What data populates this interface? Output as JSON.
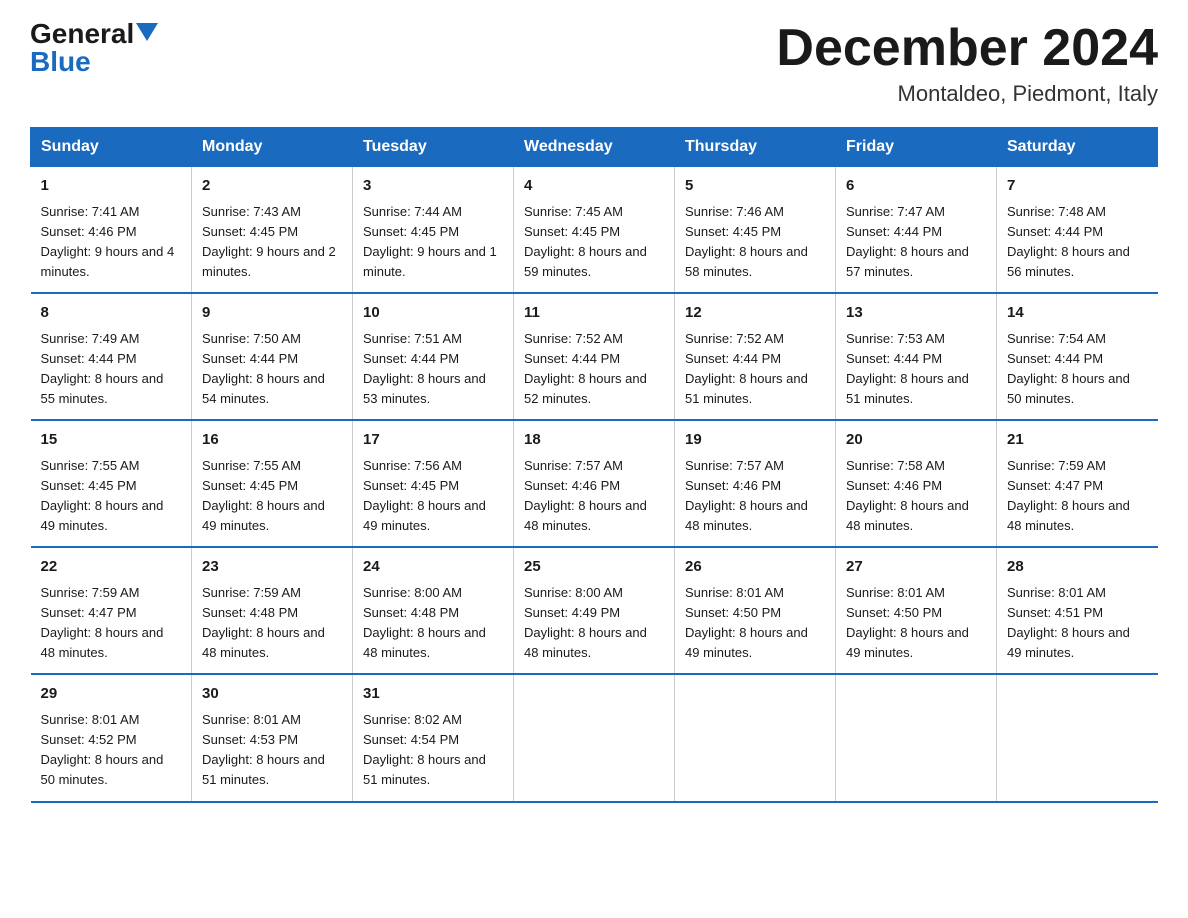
{
  "header": {
    "logo_general": "General",
    "logo_blue": "Blue",
    "month": "December 2024",
    "location": "Montaldeo, Piedmont, Italy"
  },
  "days_of_week": [
    "Sunday",
    "Monday",
    "Tuesday",
    "Wednesday",
    "Thursday",
    "Friday",
    "Saturday"
  ],
  "weeks": [
    [
      {
        "day": "1",
        "sunrise": "7:41 AM",
        "sunset": "4:46 PM",
        "daylight": "9 hours and 4 minutes."
      },
      {
        "day": "2",
        "sunrise": "7:43 AM",
        "sunset": "4:45 PM",
        "daylight": "9 hours and 2 minutes."
      },
      {
        "day": "3",
        "sunrise": "7:44 AM",
        "sunset": "4:45 PM",
        "daylight": "9 hours and 1 minute."
      },
      {
        "day": "4",
        "sunrise": "7:45 AM",
        "sunset": "4:45 PM",
        "daylight": "8 hours and 59 minutes."
      },
      {
        "day": "5",
        "sunrise": "7:46 AM",
        "sunset": "4:45 PM",
        "daylight": "8 hours and 58 minutes."
      },
      {
        "day": "6",
        "sunrise": "7:47 AM",
        "sunset": "4:44 PM",
        "daylight": "8 hours and 57 minutes."
      },
      {
        "day": "7",
        "sunrise": "7:48 AM",
        "sunset": "4:44 PM",
        "daylight": "8 hours and 56 minutes."
      }
    ],
    [
      {
        "day": "8",
        "sunrise": "7:49 AM",
        "sunset": "4:44 PM",
        "daylight": "8 hours and 55 minutes."
      },
      {
        "day": "9",
        "sunrise": "7:50 AM",
        "sunset": "4:44 PM",
        "daylight": "8 hours and 54 minutes."
      },
      {
        "day": "10",
        "sunrise": "7:51 AM",
        "sunset": "4:44 PM",
        "daylight": "8 hours and 53 minutes."
      },
      {
        "day": "11",
        "sunrise": "7:52 AM",
        "sunset": "4:44 PM",
        "daylight": "8 hours and 52 minutes."
      },
      {
        "day": "12",
        "sunrise": "7:52 AM",
        "sunset": "4:44 PM",
        "daylight": "8 hours and 51 minutes."
      },
      {
        "day": "13",
        "sunrise": "7:53 AM",
        "sunset": "4:44 PM",
        "daylight": "8 hours and 51 minutes."
      },
      {
        "day": "14",
        "sunrise": "7:54 AM",
        "sunset": "4:44 PM",
        "daylight": "8 hours and 50 minutes."
      }
    ],
    [
      {
        "day": "15",
        "sunrise": "7:55 AM",
        "sunset": "4:45 PM",
        "daylight": "8 hours and 49 minutes."
      },
      {
        "day": "16",
        "sunrise": "7:55 AM",
        "sunset": "4:45 PM",
        "daylight": "8 hours and 49 minutes."
      },
      {
        "day": "17",
        "sunrise": "7:56 AM",
        "sunset": "4:45 PM",
        "daylight": "8 hours and 49 minutes."
      },
      {
        "day": "18",
        "sunrise": "7:57 AM",
        "sunset": "4:46 PM",
        "daylight": "8 hours and 48 minutes."
      },
      {
        "day": "19",
        "sunrise": "7:57 AM",
        "sunset": "4:46 PM",
        "daylight": "8 hours and 48 minutes."
      },
      {
        "day": "20",
        "sunrise": "7:58 AM",
        "sunset": "4:46 PM",
        "daylight": "8 hours and 48 minutes."
      },
      {
        "day": "21",
        "sunrise": "7:59 AM",
        "sunset": "4:47 PM",
        "daylight": "8 hours and 48 minutes."
      }
    ],
    [
      {
        "day": "22",
        "sunrise": "7:59 AM",
        "sunset": "4:47 PM",
        "daylight": "8 hours and 48 minutes."
      },
      {
        "day": "23",
        "sunrise": "7:59 AM",
        "sunset": "4:48 PM",
        "daylight": "8 hours and 48 minutes."
      },
      {
        "day": "24",
        "sunrise": "8:00 AM",
        "sunset": "4:48 PM",
        "daylight": "8 hours and 48 minutes."
      },
      {
        "day": "25",
        "sunrise": "8:00 AM",
        "sunset": "4:49 PM",
        "daylight": "8 hours and 48 minutes."
      },
      {
        "day": "26",
        "sunrise": "8:01 AM",
        "sunset": "4:50 PM",
        "daylight": "8 hours and 49 minutes."
      },
      {
        "day": "27",
        "sunrise": "8:01 AM",
        "sunset": "4:50 PM",
        "daylight": "8 hours and 49 minutes."
      },
      {
        "day": "28",
        "sunrise": "8:01 AM",
        "sunset": "4:51 PM",
        "daylight": "8 hours and 49 minutes."
      }
    ],
    [
      {
        "day": "29",
        "sunrise": "8:01 AM",
        "sunset": "4:52 PM",
        "daylight": "8 hours and 50 minutes."
      },
      {
        "day": "30",
        "sunrise": "8:01 AM",
        "sunset": "4:53 PM",
        "daylight": "8 hours and 51 minutes."
      },
      {
        "day": "31",
        "sunrise": "8:02 AM",
        "sunset": "4:54 PM",
        "daylight": "8 hours and 51 minutes."
      },
      null,
      null,
      null,
      null
    ]
  ],
  "colors": {
    "header_bg": "#1a6bbf",
    "header_text": "#ffffff",
    "border": "#1a6bbf",
    "text": "#1a1a1a"
  }
}
